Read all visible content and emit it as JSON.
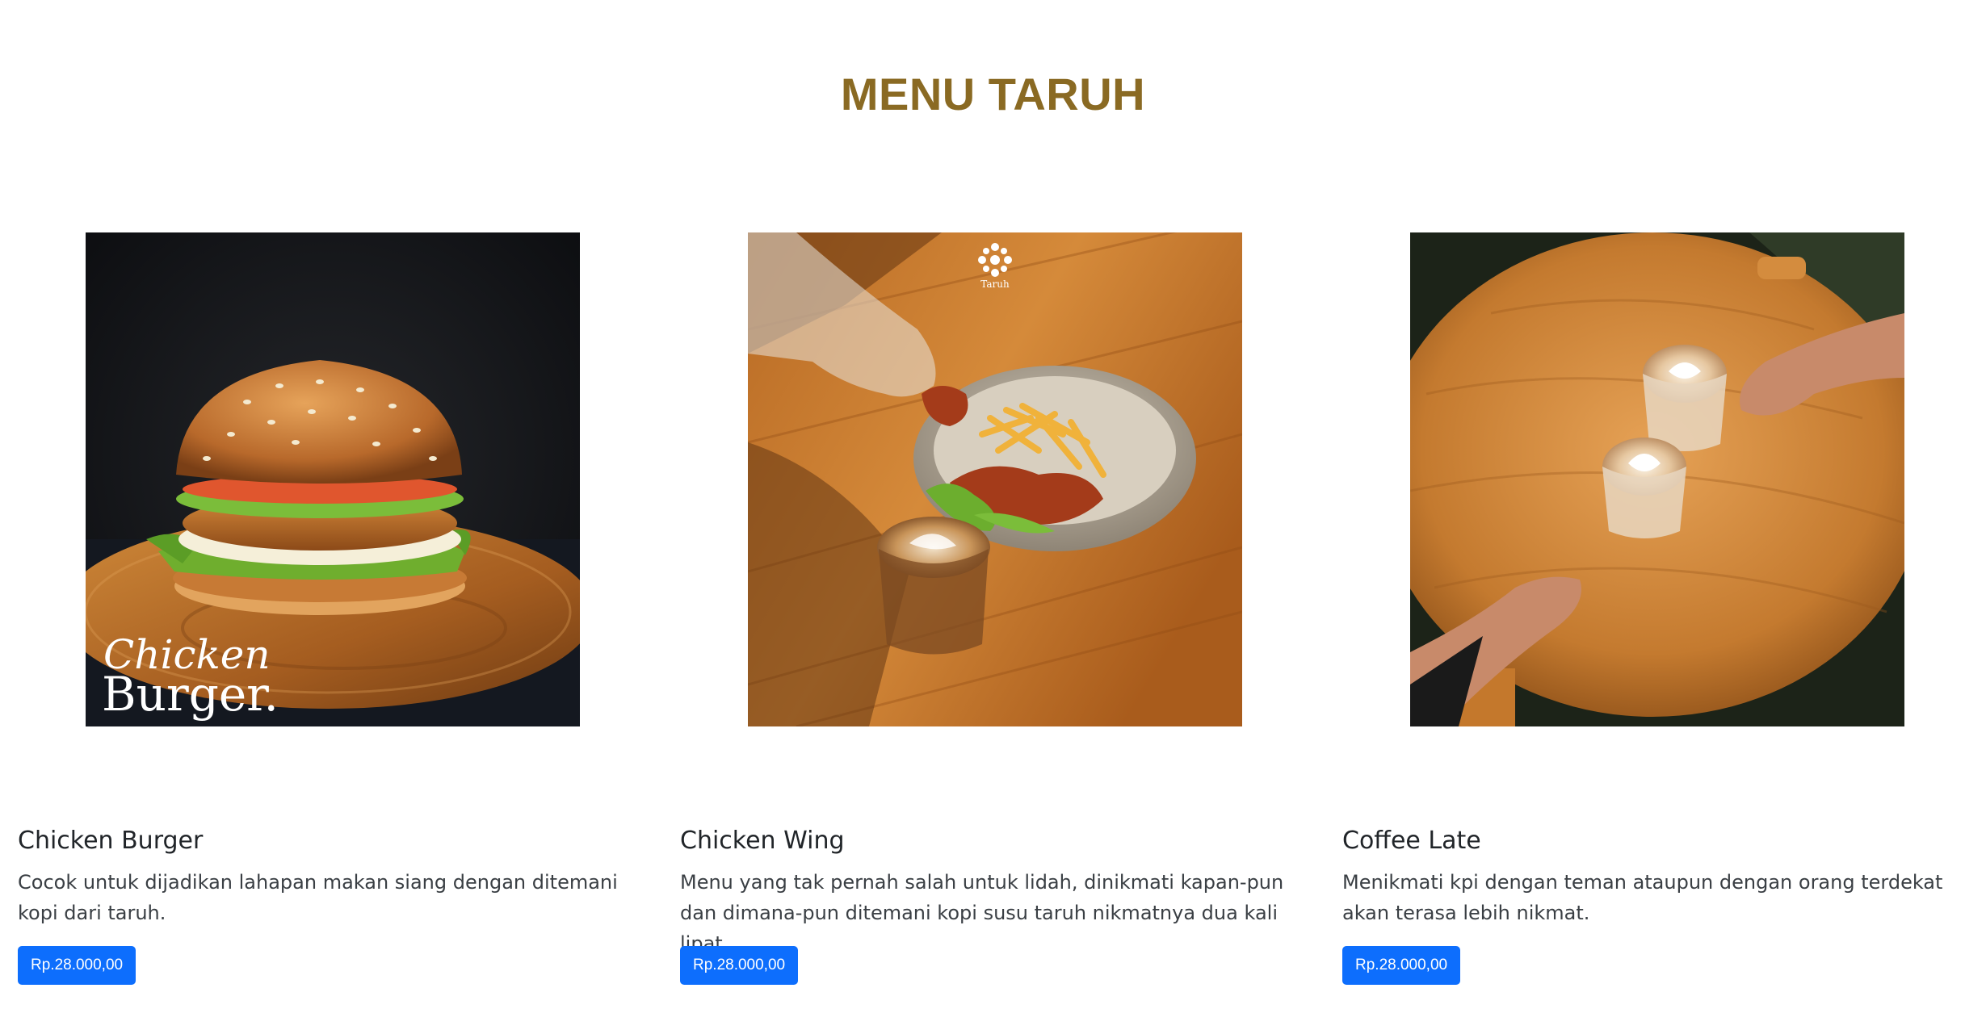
{
  "page": {
    "title": "MENU TARUH"
  },
  "menu": [
    {
      "name": "Chicken Burger",
      "description": "Cocok untuk dijadikan lahapan makan siang dengan ditemani kopi dari taruh.",
      "price": "Rp.28.000,00",
      "image_overlay_line1": "Chicken",
      "image_overlay_line2": "Burger."
    },
    {
      "name": "Chicken Wing",
      "description": "Menu yang tak pernah salah untuk lidah, dinikmati kapan-pun dan dimana-pun ditemani kopi susu taruh nikmatnya dua kali lipat.",
      "price": "Rp.28.000,00",
      "image_logo_text": "Taruh"
    },
    {
      "name": "Coffee Late",
      "description": "Menikmati kpi dengan teman ataupun dengan orang terdekat akan terasa lebih nikmat.",
      "price": "Rp.28.000,00"
    }
  ],
  "colors": {
    "title": "#8a6a23",
    "button": "#0d6efd",
    "wood": "#c4782c"
  }
}
